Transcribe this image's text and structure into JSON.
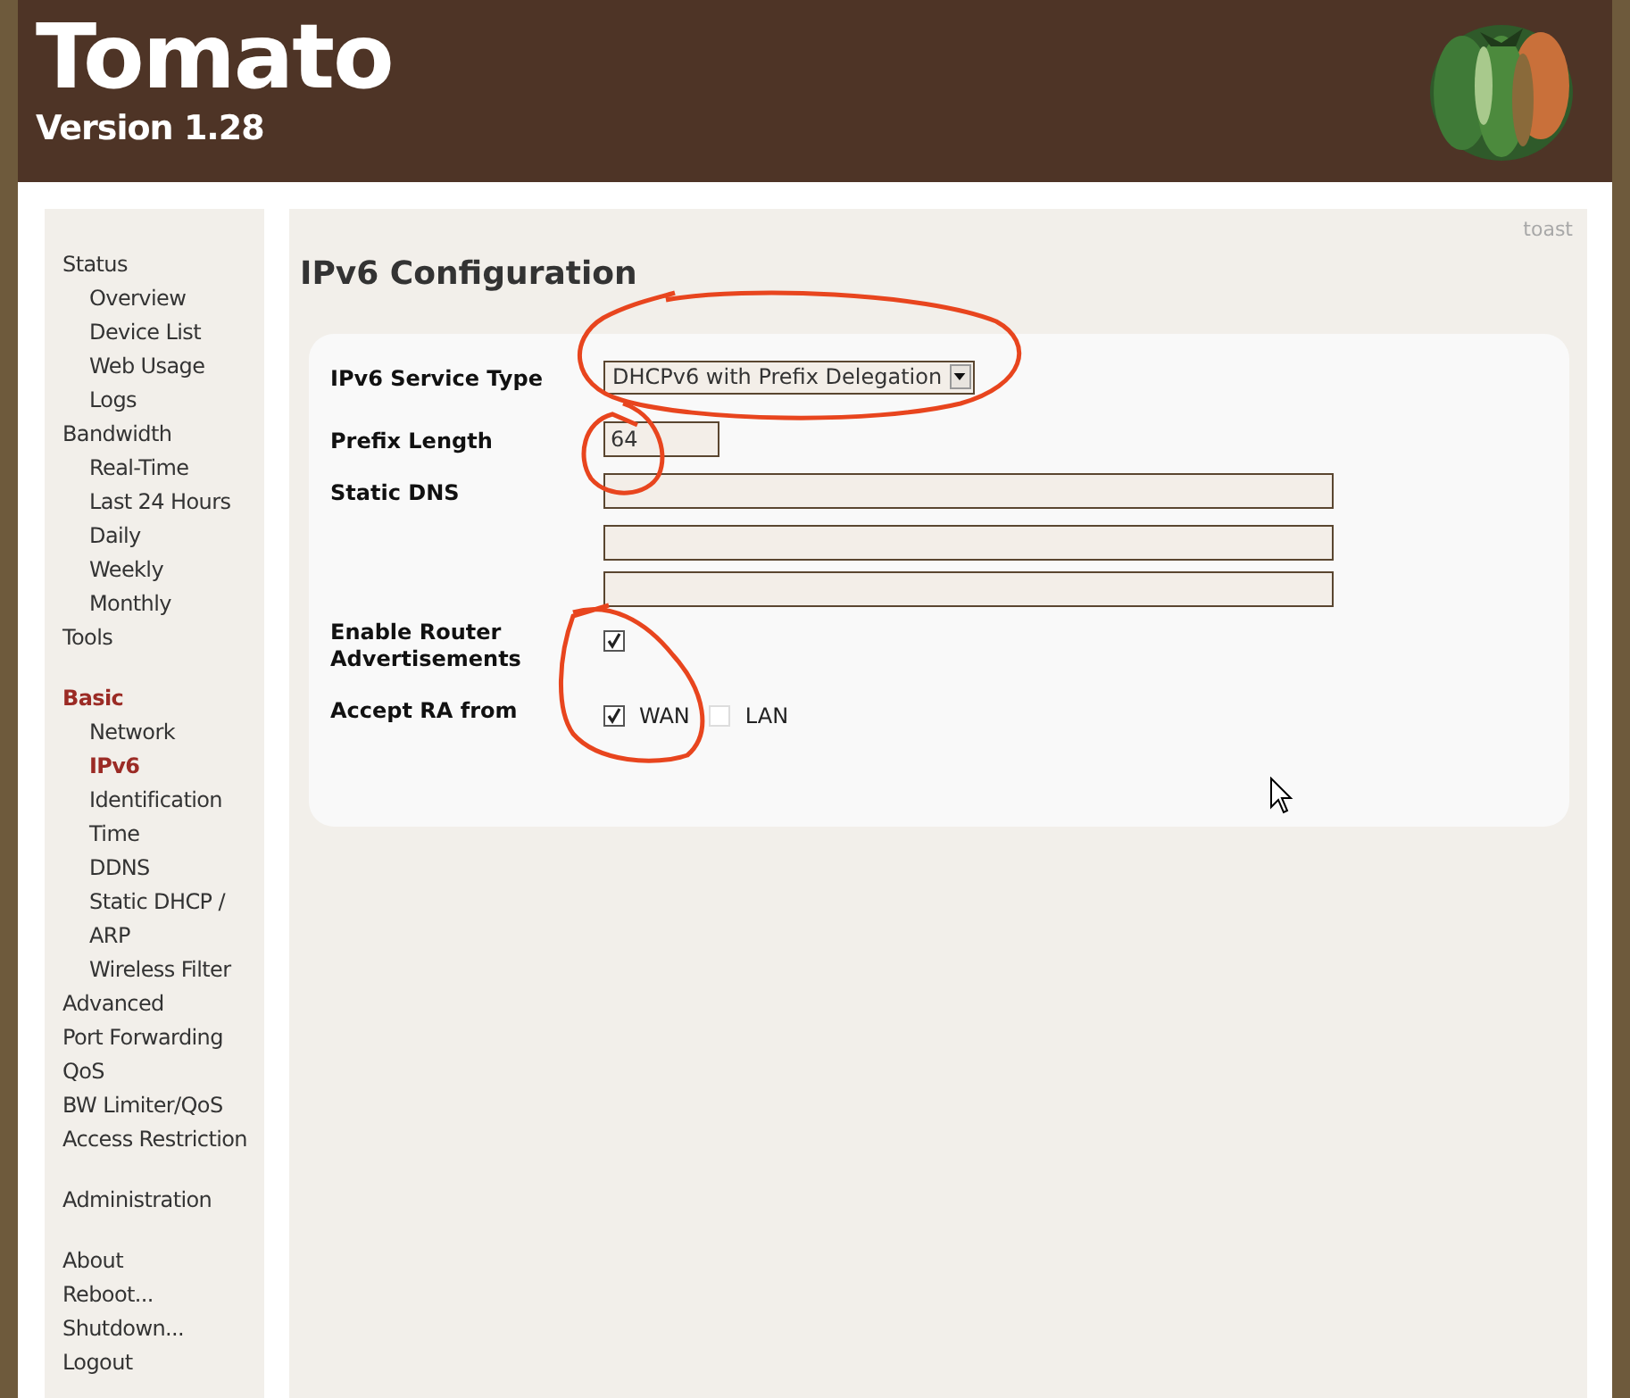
{
  "header": {
    "title": "Tomato",
    "version": "Version 1.28"
  },
  "sidebar": {
    "sections": [
      {
        "items": [
          {
            "label": "Status",
            "selected": false,
            "children": [
              {
                "label": "Overview",
                "selected": false
              },
              {
                "label": "Device List",
                "selected": false
              },
              {
                "label": "Web Usage",
                "selected": false
              },
              {
                "label": "Logs",
                "selected": false
              }
            ]
          },
          {
            "label": "Bandwidth",
            "selected": false,
            "children": [
              {
                "label": "Real-Time",
                "selected": false
              },
              {
                "label": "Last 24 Hours",
                "selected": false
              },
              {
                "label": "Daily",
                "selected": false
              },
              {
                "label": "Weekly",
                "selected": false
              },
              {
                "label": "Monthly",
                "selected": false
              }
            ]
          },
          {
            "label": "Tools",
            "selected": false
          }
        ]
      },
      {
        "items": [
          {
            "label": "Basic",
            "selected": true,
            "children": [
              {
                "label": "Network",
                "selected": false
              },
              {
                "label": "IPv6",
                "selected": true
              },
              {
                "label": "Identification",
                "selected": false
              },
              {
                "label": "Time",
                "selected": false
              },
              {
                "label": "DDNS",
                "selected": false
              },
              {
                "label": "Static DHCP / ARP",
                "selected": false
              },
              {
                "label": "Wireless Filter",
                "selected": false
              }
            ]
          },
          {
            "label": "Advanced",
            "selected": false
          },
          {
            "label": "Port Forwarding",
            "selected": false
          },
          {
            "label": "QoS",
            "selected": false
          },
          {
            "label": "BW Limiter/QoS",
            "selected": false
          },
          {
            "label": "Access Restriction",
            "selected": false
          }
        ]
      },
      {
        "items": [
          {
            "label": "Administration",
            "selected": false
          }
        ]
      },
      {
        "items": [
          {
            "label": "About",
            "selected": false
          },
          {
            "label": "Reboot...",
            "selected": false
          },
          {
            "label": "Shutdown...",
            "selected": false
          },
          {
            "label": "Logout",
            "selected": false
          }
        ]
      }
    ]
  },
  "main": {
    "user": "toast",
    "title": "IPv6 Configuration",
    "fields": [
      {
        "kind": "select",
        "label": "IPv6 Service Type",
        "value": "DHCPv6 with Prefix Delegation"
      },
      {
        "kind": "text",
        "label": "Prefix Length",
        "value": "64"
      },
      {
        "kind": "text_list",
        "label": "Static DNS",
        "inputs": [
          {
            "kind": "text"
          },
          {
            "kind": "text"
          },
          {
            "kind": "text"
          }
        ]
      },
      {
        "kind": "checkbox",
        "label": "Enable Router Advertisements",
        "checked": true
      },
      {
        "kind": "checkbox_group",
        "label": "Accept RA from",
        "options": [
          {
            "label": "WAN",
            "checked": true
          },
          {
            "label": "LAN",
            "checked": false
          }
        ]
      }
    ]
  }
}
